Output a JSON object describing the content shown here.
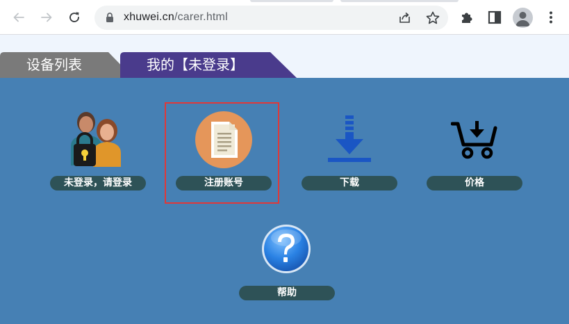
{
  "browser": {
    "url_host": "xhuwei.cn",
    "url_path": "/carer.html",
    "icons": [
      "back-arrow-icon",
      "forward-arrow-icon",
      "reload-icon",
      "lock-icon",
      "share-icon",
      "star-icon",
      "extensions-icon",
      "side-panel-icon",
      "profile-icon",
      "menu-dots-icon"
    ]
  },
  "tabs": [
    {
      "label": "设备列表",
      "color": "#7a7a7a"
    },
    {
      "label": "我的【未登录】",
      "color": "#4a3b8c"
    }
  ],
  "tiles": [
    {
      "label": "未登录，请登录",
      "icon": "users-lock-icon"
    },
    {
      "label": "注册账号",
      "icon": "document-icon"
    },
    {
      "label": "下载",
      "icon": "download-icon"
    },
    {
      "label": "价格",
      "icon": "cart-icon"
    },
    {
      "label": "帮助",
      "icon": "help-icon"
    }
  ],
  "colors": {
    "content_bg": "#4680b4",
    "pill_bg": "#2e5257",
    "highlight_border": "#e03838",
    "page_top_bg": "#eff5fd"
  }
}
